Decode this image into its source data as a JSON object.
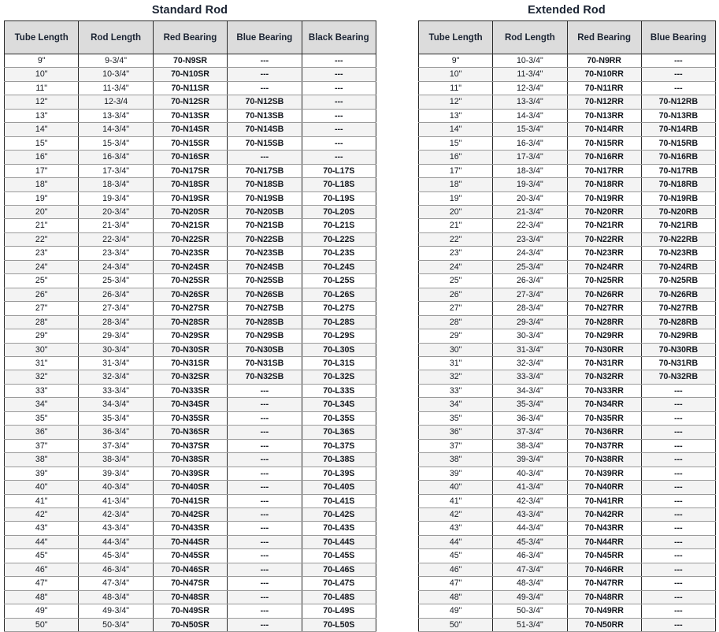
{
  "page": {
    "background_color": "#ffffff",
    "header_fill": "#dcdcdc",
    "row_alt_fill": "#f3f3f3",
    "border_color": "#2b2b2b",
    "text_color": "#14181f",
    "dash_placeholder": "---"
  },
  "tables": [
    {
      "id": "standard-rod",
      "title": "Standard Rod",
      "columns": [
        "Tube Length",
        "Rod Length",
        "Red Bearing",
        "Blue Bearing",
        "Black Bearing"
      ],
      "rows": [
        [
          "9\"",
          "9-3/4\"",
          "70-N9SR",
          "---",
          "---"
        ],
        [
          "10\"",
          "10-3/4\"",
          "70-N10SR",
          "---",
          "---"
        ],
        [
          "11\"",
          "11-3/4\"",
          "70-N11SR",
          "---",
          "---"
        ],
        [
          "12\"",
          "12-3/4",
          "70-N12SR",
          "70-N12SB",
          "---"
        ],
        [
          "13\"",
          "13-3/4\"",
          "70-N13SR",
          "70-N13SB",
          "---"
        ],
        [
          "14\"",
          "14-3/4\"",
          "70-N14SR",
          "70-N14SB",
          "---"
        ],
        [
          "15\"",
          "15-3/4\"",
          "70-N15SR",
          "70-N15SB",
          "---"
        ],
        [
          "16\"",
          "16-3/4\"",
          "70-N16SR",
          "---",
          "---"
        ],
        [
          "17\"",
          "17-3/4\"",
          "70-N17SR",
          "70-N17SB",
          "70-L17S"
        ],
        [
          "18\"",
          "18-3/4\"",
          "70-N18SR",
          "70-N18SB",
          "70-L18S"
        ],
        [
          "19\"",
          "19-3/4\"",
          "70-N19SR",
          "70-N19SB",
          "70-L19S"
        ],
        [
          "20\"",
          "20-3/4\"",
          "70-N20SR",
          "70-N20SB",
          "70-L20S"
        ],
        [
          "21\"",
          "21-3/4\"",
          "70-N21SR",
          "70-N21SB",
          "70-L21S"
        ],
        [
          "22\"",
          "22-3/4\"",
          "70-N22SR",
          "70-N22SB",
          "70-L22S"
        ],
        [
          "23\"",
          "23-3/4\"",
          "70-N23SR",
          "70-N23SB",
          "70-L23S"
        ],
        [
          "24\"",
          "24-3/4\"",
          "70-N24SR",
          "70-N24SB",
          "70-L24S"
        ],
        [
          "25\"",
          "25-3/4\"",
          "70-N25SR",
          "70-N25SB",
          "70-L25S"
        ],
        [
          "26\"",
          "26-3/4\"",
          "70-N26SR",
          "70-N26SB",
          "70-L26S"
        ],
        [
          "27\"",
          "27-3/4\"",
          "70-N27SR",
          "70-N27SB",
          "70-L27S"
        ],
        [
          "28\"",
          "28-3/4\"",
          "70-N28SR",
          "70-N28SB",
          "70-L28S"
        ],
        [
          "29\"",
          "29-3/4\"",
          "70-N29SR",
          "70-N29SB",
          "70-L29S"
        ],
        [
          "30\"",
          "30-3/4\"",
          "70-N30SR",
          "70-N30SB",
          "70-L30S"
        ],
        [
          "31\"",
          "31-3/4\"",
          "70-N31SR",
          "70-N31SB",
          "70-L31S"
        ],
        [
          "32\"",
          "32-3/4\"",
          "70-N32SR",
          "70-N32SB",
          "70-L32S"
        ],
        [
          "33\"",
          "33-3/4\"",
          "70-N33SR",
          "---",
          "70-L33S"
        ],
        [
          "34\"",
          "34-3/4\"",
          "70-N34SR",
          "---",
          "70-L34S"
        ],
        [
          "35\"",
          "35-3/4\"",
          "70-N35SR",
          "---",
          "70-L35S"
        ],
        [
          "36\"",
          "36-3/4\"",
          "70-N36SR",
          "---",
          "70-L36S"
        ],
        [
          "37\"",
          "37-3/4\"",
          "70-N37SR",
          "---",
          "70-L37S"
        ],
        [
          "38\"",
          "38-3/4\"",
          "70-N38SR",
          "---",
          "70-L38S"
        ],
        [
          "39\"",
          "39-3/4\"",
          "70-N39SR",
          "---",
          "70-L39S"
        ],
        [
          "40\"",
          "40-3/4\"",
          "70-N40SR",
          "---",
          "70-L40S"
        ],
        [
          "41\"",
          "41-3/4\"",
          "70-N41SR",
          "---",
          "70-L41S"
        ],
        [
          "42\"",
          "42-3/4\"",
          "70-N42SR",
          "---",
          "70-L42S"
        ],
        [
          "43\"",
          "43-3/4\"",
          "70-N43SR",
          "---",
          "70-L43S"
        ],
        [
          "44\"",
          "44-3/4\"",
          "70-N44SR",
          "---",
          "70-L44S"
        ],
        [
          "45\"",
          "45-3/4\"",
          "70-N45SR",
          "---",
          "70-L45S"
        ],
        [
          "46\"",
          "46-3/4\"",
          "70-N46SR",
          "---",
          "70-L46S"
        ],
        [
          "47\"",
          "47-3/4\"",
          "70-N47SR",
          "---",
          "70-L47S"
        ],
        [
          "48\"",
          "48-3/4\"",
          "70-N48SR",
          "---",
          "70-L48S"
        ],
        [
          "49\"",
          "49-3/4\"",
          "70-N49SR",
          "---",
          "70-L49S"
        ],
        [
          "50\"",
          "50-3/4\"",
          "70-N50SR",
          "---",
          "70-L50S"
        ]
      ]
    },
    {
      "id": "extended-rod",
      "title": "Extended Rod",
      "columns": [
        "Tube Length",
        "Rod Length",
        "Red Bearing",
        "Blue Bearing"
      ],
      "rows": [
        [
          "9\"",
          "10-3/4\"",
          "70-N9RR",
          "---"
        ],
        [
          "10\"",
          "11-3/4\"",
          "70-N10RR",
          "---"
        ],
        [
          "11\"",
          "12-3/4\"",
          "70-N11RR",
          "---"
        ],
        [
          "12\"",
          "13-3/4\"",
          "70-N12RR",
          "70-N12RB"
        ],
        [
          "13\"",
          "14-3/4\"",
          "70-N13RR",
          "70-N13RB"
        ],
        [
          "14\"",
          "15-3/4\"",
          "70-N14RR",
          "70-N14RB"
        ],
        [
          "15\"",
          "16-3/4\"",
          "70-N15RR",
          "70-N15RB"
        ],
        [
          "16\"",
          "17-3/4\"",
          "70-N16RR",
          "70-N16RB"
        ],
        [
          "17\"",
          "18-3/4\"",
          "70-N17RR",
          "70-N17RB"
        ],
        [
          "18\"",
          "19-3/4\"",
          "70-N18RR",
          "70-N18RB"
        ],
        [
          "19\"",
          "20-3/4\"",
          "70-N19RR",
          "70-N19RB"
        ],
        [
          "20\"",
          "21-3/4\"",
          "70-N20RR",
          "70-N20RB"
        ],
        [
          "21\"",
          "22-3/4\"",
          "70-N21RR",
          "70-N21RB"
        ],
        [
          "22\"",
          "23-3/4\"",
          "70-N22RR",
          "70-N22RB"
        ],
        [
          "23\"",
          "24-3/4\"",
          "70-N23RR",
          "70-N23RB"
        ],
        [
          "24\"",
          "25-3/4\"",
          "70-N24RR",
          "70-N24RB"
        ],
        [
          "25\"",
          "26-3/4\"",
          "70-N25RR",
          "70-N25RB"
        ],
        [
          "26\"",
          "27-3/4\"",
          "70-N26RR",
          "70-N26RB"
        ],
        [
          "27\"",
          "28-3/4\"",
          "70-N27RR",
          "70-N27RB"
        ],
        [
          "28\"",
          "29-3/4\"",
          "70-N28RR",
          "70-N28RB"
        ],
        [
          "29\"",
          "30-3/4\"",
          "70-N29RR",
          "70-N29RB"
        ],
        [
          "30\"",
          "31-3/4\"",
          "70-N30RR",
          "70-N30RB"
        ],
        [
          "31\"",
          "32-3/4\"",
          "70-N31RR",
          "70-N31RB"
        ],
        [
          "32\"",
          "33-3/4\"",
          "70-N32RR",
          "70-N32RB"
        ],
        [
          "33\"",
          "34-3/4\"",
          "70-N33RR",
          "---"
        ],
        [
          "34\"",
          "35-3/4\"",
          "70-N34RR",
          "---"
        ],
        [
          "35\"",
          "36-3/4\"",
          "70-N35RR",
          "---"
        ],
        [
          "36\"",
          "37-3/4\"",
          "70-N36RR",
          "---"
        ],
        [
          "37\"",
          "38-3/4\"",
          "70-N37RR",
          "---"
        ],
        [
          "38\"",
          "39-3/4\"",
          "70-N38RR",
          "---"
        ],
        [
          "39\"",
          "40-3/4\"",
          "70-N39RR",
          "---"
        ],
        [
          "40\"",
          "41-3/4\"",
          "70-N40RR",
          "---"
        ],
        [
          "41\"",
          "42-3/4\"",
          "70-N41RR",
          "---"
        ],
        [
          "42\"",
          "43-3/4\"",
          "70-N42RR",
          "---"
        ],
        [
          "43\"",
          "44-3/4\"",
          "70-N43RR",
          "---"
        ],
        [
          "44\"",
          "45-3/4\"",
          "70-N44RR",
          "---"
        ],
        [
          "45\"",
          "46-3/4\"",
          "70-N45RR",
          "---"
        ],
        [
          "46\"",
          "47-3/4\"",
          "70-N46RR",
          "---"
        ],
        [
          "47\"",
          "48-3/4\"",
          "70-N47RR",
          "---"
        ],
        [
          "48\"",
          "49-3/4\"",
          "70-N48RR",
          "---"
        ],
        [
          "49\"",
          "50-3/4\"",
          "70-N49RR",
          "---"
        ],
        [
          "50\"",
          "51-3/4\"",
          "70-N50RR",
          "---"
        ]
      ]
    }
  ]
}
